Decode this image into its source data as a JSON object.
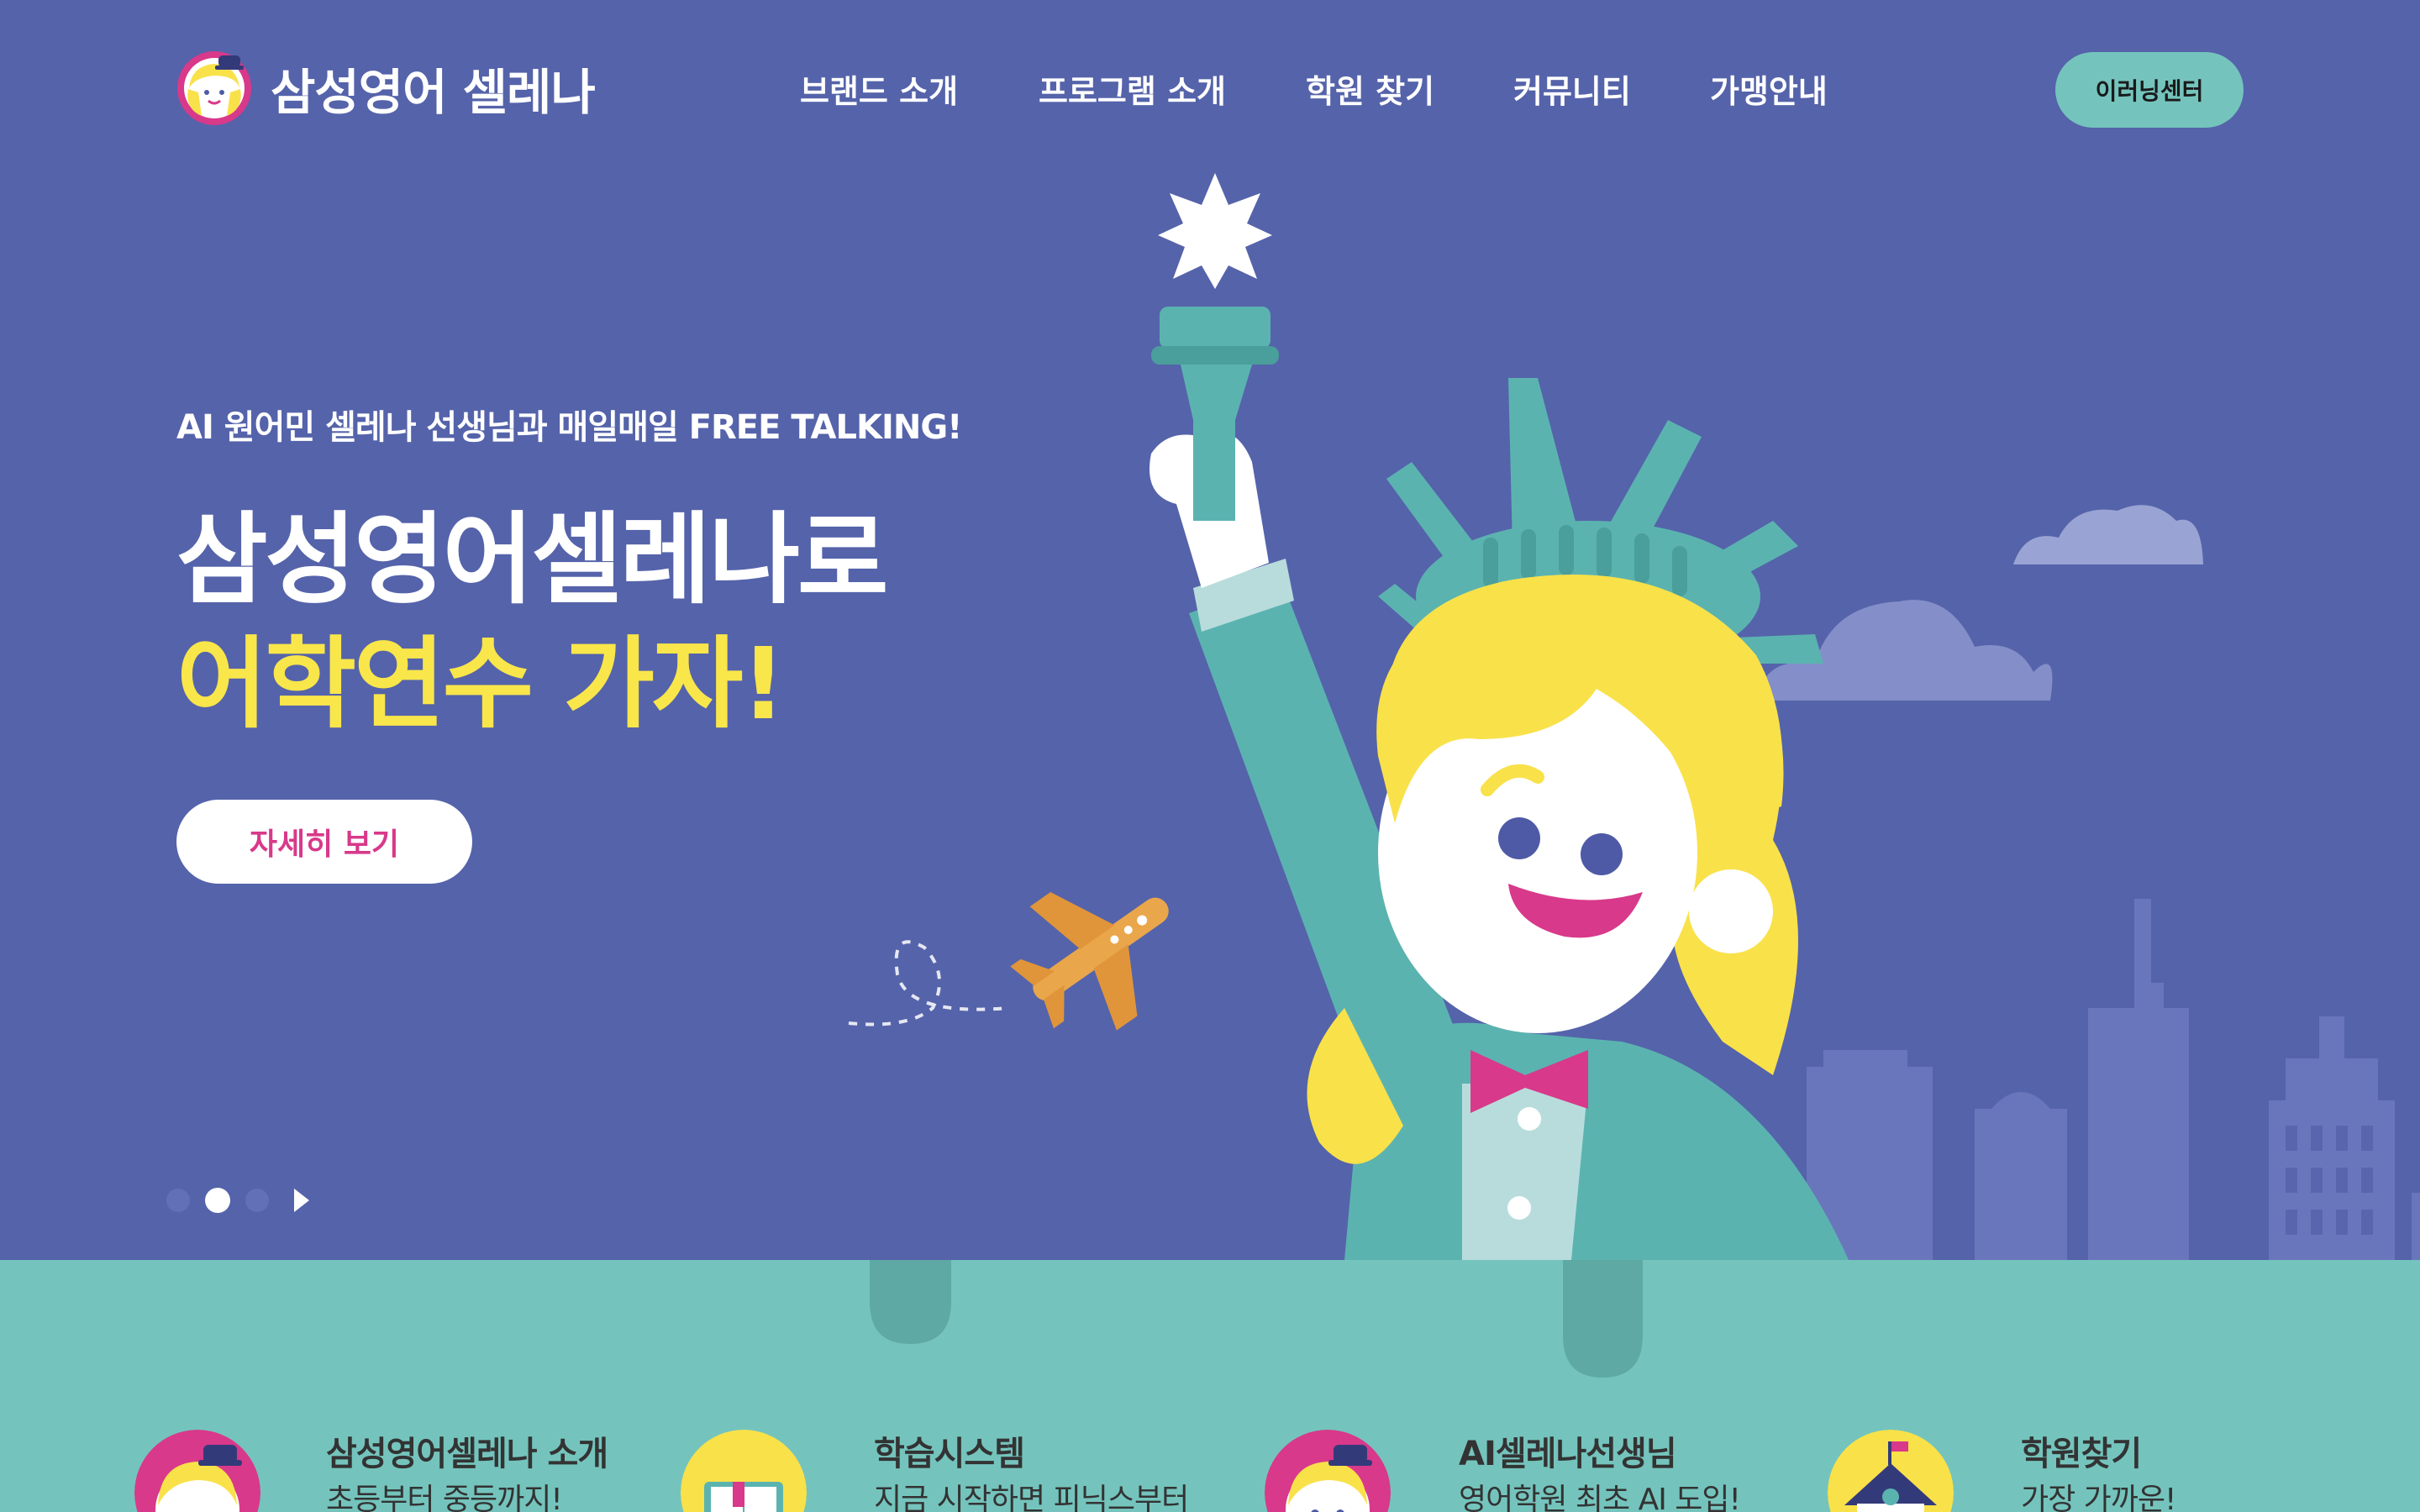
{
  "brand": {
    "name": "삼성영어 셀레나"
  },
  "nav": {
    "items": [
      {
        "label": "브랜드 소개"
      },
      {
        "label": "프로그램 소개"
      },
      {
        "label": "학원 찾기"
      },
      {
        "label": "커뮤니티"
      },
      {
        "label": "가맹안내"
      }
    ],
    "elearning_label": "이러닝센터"
  },
  "hero": {
    "tagline": "AI 원어민 셀레나 선생님과 매일매일 FREE TALKING!",
    "headline_line1": "삼성영어셀레나로",
    "headline_line2": "어학연수 가자!",
    "cta_label": "자세히 보기",
    "slider": {
      "total_dots": 3,
      "active_index": 1
    }
  },
  "features": [
    {
      "title": "삼성영어셀레나 소개",
      "subtitle": "초등부터 중등까지!",
      "icon": "selena-avatar-icon"
    },
    {
      "title": "학습시스템",
      "subtitle": "지금 시작하면 피닉스부터",
      "icon": "book-icon"
    },
    {
      "title": "AI셀레나선생님",
      "subtitle": "영어학원 최초 AI 도입!",
      "icon": "ai-teacher-icon"
    },
    {
      "title": "학원찾기",
      "subtitle": "가장 가까운!",
      "icon": "school-icon"
    }
  ],
  "colors": {
    "hero_bg": "#5563aa",
    "band_bg": "#74c4bd",
    "accent_yellow": "#f9e64a",
    "accent_pink": "#d8398a"
  }
}
